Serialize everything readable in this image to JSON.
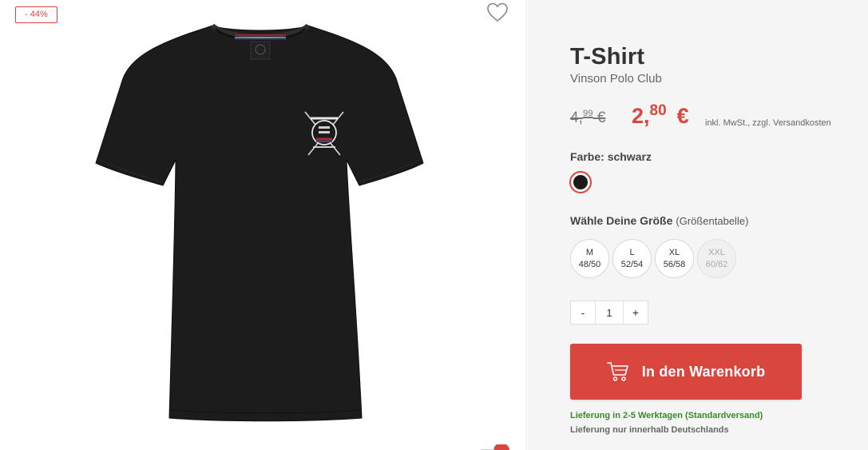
{
  "gallery": {
    "discount_badge": "- 44%"
  },
  "product": {
    "title": "T-Shirt",
    "brand": "Vinson Polo Club",
    "image_alt": "schwarzes T-Shirt mit Vinson Polo Club Logo"
  },
  "price": {
    "old_main": "4,",
    "old_cents": "99",
    "old_currency": "€",
    "new_main": "2,",
    "new_cents": "80",
    "new_currency": "€",
    "tax_note": "inkl. MwSt., zzgl. Versandkosten"
  },
  "color": {
    "label": "Farbe:",
    "value": "schwarz",
    "swatch_hex": "#1a1a1a"
  },
  "size": {
    "label": "Wähle Deine Größe",
    "chart_link": "(Größentabelle)",
    "options": [
      {
        "label": "M",
        "sub": "48/50",
        "available": true
      },
      {
        "label": "L",
        "sub": "52/54",
        "available": true
      },
      {
        "label": "XL",
        "sub": "56/58",
        "available": true
      },
      {
        "label": "XXL",
        "sub": "60/62",
        "available": false
      }
    ]
  },
  "quantity": {
    "minus": "-",
    "value": "1",
    "plus": "+"
  },
  "cart_button": {
    "label": "In den Warenkorb"
  },
  "delivery": {
    "time": "Lieferung in 2-5 Werktagen (Standardversand)",
    "area": "Lieferung nur innerhalb Deutschlands"
  },
  "colors": {
    "accent": "#d9463e",
    "delivery_green": "#3a8a2c"
  }
}
